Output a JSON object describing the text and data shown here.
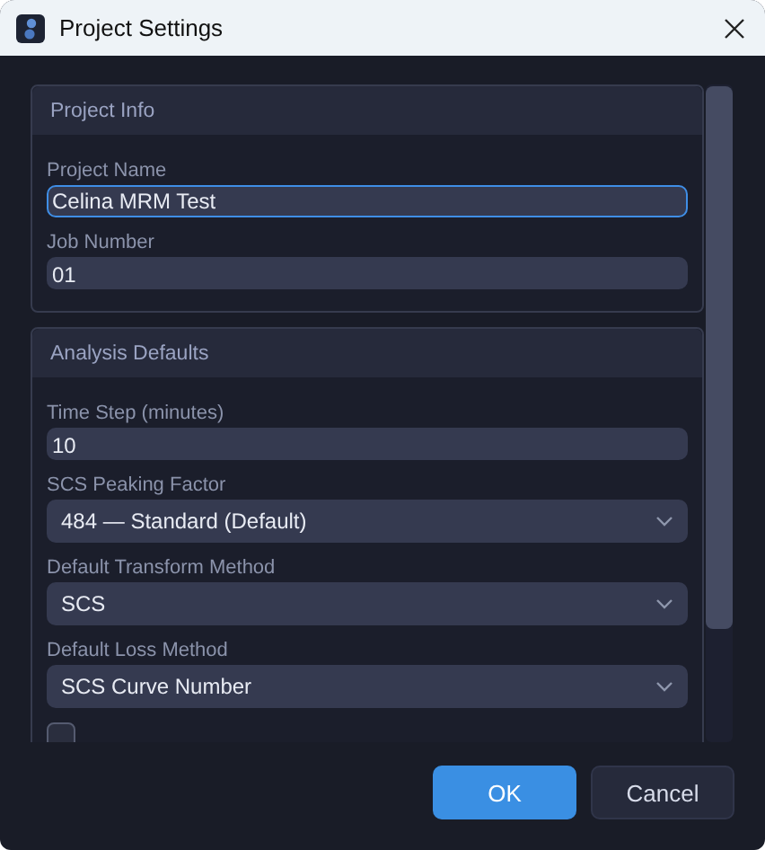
{
  "window": {
    "title": "Project Settings"
  },
  "sections": [
    {
      "title": "Project Info",
      "fields": [
        {
          "kind": "text",
          "label": "Project Name",
          "value": "Celina MRM Test",
          "focused": true
        },
        {
          "kind": "text",
          "label": "Job Number",
          "value": "01",
          "focused": false
        }
      ]
    },
    {
      "title": "Analysis Defaults",
      "fields": [
        {
          "kind": "text",
          "label": "Time Step (minutes)",
          "value": "10",
          "focused": false
        },
        {
          "kind": "select",
          "label": "SCS Peaking Factor",
          "value": "484 — Standard (Default)"
        },
        {
          "kind": "select",
          "label": "Default Transform Method",
          "value": "SCS"
        },
        {
          "kind": "select",
          "label": "Default Loss Method",
          "value": "SCS Curve Number"
        },
        {
          "kind": "checkbox",
          "checked": false
        }
      ]
    }
  ],
  "buttons": [
    {
      "label": "OK",
      "kind": "primary"
    },
    {
      "label": "Cancel",
      "kind": "secondary"
    }
  ]
}
